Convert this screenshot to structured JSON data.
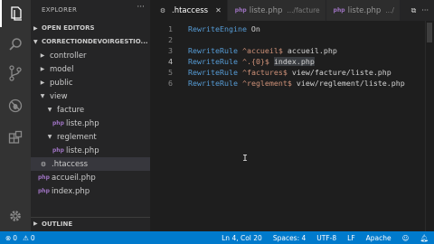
{
  "activity_bar": {
    "icons": [
      "files-icon",
      "search-icon",
      "source-control-icon",
      "debug-icon",
      "extensions-icon",
      "gear-icon"
    ]
  },
  "sidebar": {
    "title": "EXPLORER",
    "more": "···",
    "open_editors_label": "OPEN EDITORS",
    "folder_label": "CORRECTIONDEVOIRGESTIO...",
    "tree": [
      {
        "label": "controller",
        "type": "folder",
        "expanded": false
      },
      {
        "label": "model",
        "type": "folder",
        "expanded": false
      },
      {
        "label": "public",
        "type": "folder",
        "expanded": false
      },
      {
        "label": "view",
        "type": "folder",
        "expanded": true
      },
      {
        "label": "facture",
        "type": "folder",
        "expanded": true
      },
      {
        "label": "liste.php",
        "type": "php"
      },
      {
        "label": "reglement",
        "type": "folder",
        "expanded": true
      },
      {
        "label": "liste.php",
        "type": "php"
      },
      {
        "label": ".htaccess",
        "type": "htaccess",
        "selected": true
      },
      {
        "label": "accueil.php",
        "type": "php"
      },
      {
        "label": "index.php",
        "type": "php"
      }
    ],
    "outline_label": "OUTLINE"
  },
  "tabs": [
    {
      "label": ".htaccess",
      "desc": "",
      "active": true,
      "icon": "htaccess"
    },
    {
      "label": "liste.php",
      "desc": ".../facture",
      "active": false,
      "icon": "php"
    },
    {
      "label": "liste.php",
      "desc": ".../",
      "active": false,
      "icon": "php"
    }
  ],
  "editor": {
    "lines": [
      {
        "num": "1",
        "parts": [
          {
            "c": "k",
            "t": "RewriteEngine"
          },
          {
            "c": "t",
            "t": " On"
          }
        ]
      },
      {
        "num": "2",
        "parts": []
      },
      {
        "num": "3",
        "parts": [
          {
            "c": "k",
            "t": "RewriteRule"
          },
          {
            "c": "t",
            "t": " "
          },
          {
            "c": "s",
            "t": "^accueil$"
          },
          {
            "c": "t",
            "t": " accueil.php"
          }
        ]
      },
      {
        "num": "4",
        "parts": [
          {
            "c": "k",
            "t": "RewriteRule"
          },
          {
            "c": "t",
            "t": " "
          },
          {
            "c": "s",
            "t": "^.{0}$"
          },
          {
            "c": "t",
            "t": " "
          },
          {
            "c": "t hl",
            "t": "index.php"
          }
        ]
      },
      {
        "num": "5",
        "parts": [
          {
            "c": "k",
            "t": "RewriteRule"
          },
          {
            "c": "t",
            "t": " "
          },
          {
            "c": "s",
            "t": "^factures$"
          },
          {
            "c": "t",
            "t": " view/facture/liste.php"
          }
        ]
      },
      {
        "num": "6",
        "parts": [
          {
            "c": "k",
            "t": "RewriteRule"
          },
          {
            "c": "t",
            "t": " "
          },
          {
            "c": "s",
            "t": "^reglement$"
          },
          {
            "c": "t",
            "t": " view/reglement/liste.php"
          }
        ]
      }
    ],
    "current_line": "4",
    "mouse_cursor": "I"
  },
  "statusbar": {
    "errors": "0",
    "warnings": "0",
    "position": "Ln 4, Col 20",
    "spaces": "Spaces: 4",
    "encoding": "UTF-8",
    "eol": "LF",
    "language": "Apache"
  },
  "colors": {
    "statusbar": "#007acc",
    "keyword": "#569cd6",
    "string": "#ce9178"
  }
}
